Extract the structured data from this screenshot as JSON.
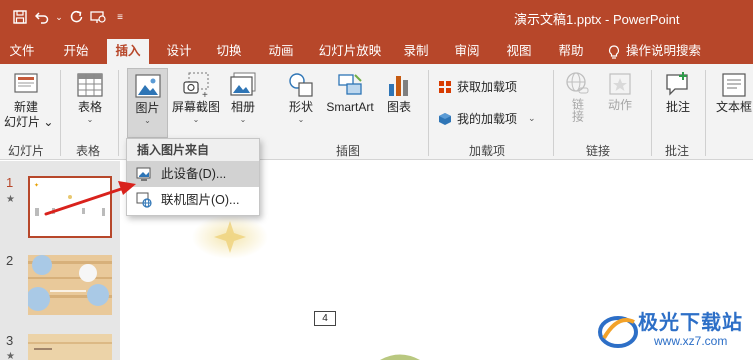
{
  "window": {
    "title": "演示文稿1.pptx  -  PowerPoint"
  },
  "tabs": [
    {
      "label": "文件"
    },
    {
      "label": "开始"
    },
    {
      "label": "插入"
    },
    {
      "label": "设计"
    },
    {
      "label": "切换"
    },
    {
      "label": "动画"
    },
    {
      "label": "幻灯片放映"
    },
    {
      "label": "录制"
    },
    {
      "label": "审阅"
    },
    {
      "label": "视图"
    },
    {
      "label": "帮助"
    },
    {
      "label": "操作说明搜索"
    }
  ],
  "ribbon": {
    "new_slide": "新建\n幻灯片",
    "new_slide_line1": "新建",
    "new_slide_line2": "幻灯片 ⌄",
    "table": "表格",
    "picture": "图片",
    "screenshot": "屏幕截图",
    "album": "相册",
    "shapes": "形状",
    "smartart": "SmartArt",
    "chart": "图表",
    "get_addins": "获取加载项",
    "my_addins": "我的加载项",
    "link": "链接",
    "action": "动作",
    "comment": "批注",
    "textbox": "文本框",
    "groups": {
      "slides": "幻灯片",
      "tables": "表格",
      "illustrations": "插图",
      "addins": "加载项",
      "links": "链接",
      "comments": "批注"
    }
  },
  "dropdown": {
    "header": "插入图片来自",
    "items": [
      {
        "label": "此设备(D)..."
      },
      {
        "label": "联机图片(O)..."
      }
    ]
  },
  "slides_panel": {
    "slides": [
      {
        "number": "1",
        "mark": "★"
      },
      {
        "number": "2"
      },
      {
        "number": "3",
        "mark": "★"
      }
    ]
  },
  "canvas": {
    "slide_number_box": "4"
  },
  "watermark": {
    "title": "极光下载站",
    "url": "www.xz7.com"
  },
  "colors": {
    "brand": "#b7472a",
    "ribbon_bg": "#f3f3f3",
    "panel_bg": "#e6e6e6",
    "arrow": "#d9221c",
    "watermark": "#2d6fc7"
  }
}
